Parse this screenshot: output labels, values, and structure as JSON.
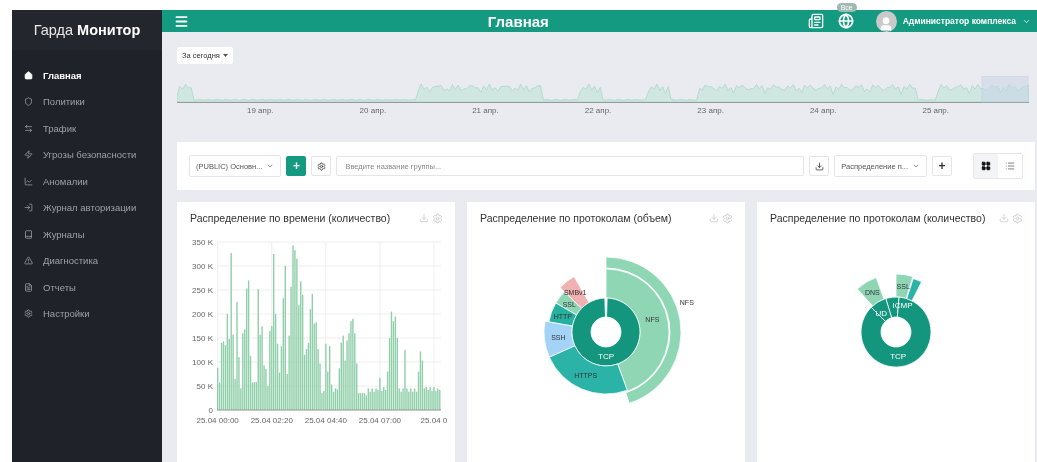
{
  "sidebar": {
    "brand_light": "Гарда",
    "brand_bold": "Монитор",
    "items": [
      {
        "label": "Главная",
        "selected": true
      },
      {
        "label": "Политики",
        "selected": false
      },
      {
        "label": "Трафик",
        "selected": false
      },
      {
        "label": "Угрозы безопасности",
        "selected": false
      },
      {
        "label": "Аномалии",
        "selected": false
      },
      {
        "label": "Журнал авторизации",
        "selected": false
      },
      {
        "label": "Журналы",
        "selected": false
      },
      {
        "label": "Диагностика",
        "selected": false
      },
      {
        "label": "Отчеты",
        "selected": false
      },
      {
        "label": "Настройки",
        "selected": false
      }
    ]
  },
  "header": {
    "title": "Главная",
    "badge": "Все",
    "user": "Администратор комплекса"
  },
  "timeline": {
    "period": "За сегодня",
    "labels": [
      "19 апр.",
      "20 апр.",
      "21 апр.",
      "22 апр.",
      "23 апр.",
      "24 апр.",
      "25 апр."
    ]
  },
  "toolbar": {
    "group": "(PUBLIC) Основн...",
    "add": "+",
    "search": {
      "placeholder": "Введите название группы..."
    },
    "layout": "Распределение п...",
    "add_widget": "+",
    "views": [
      {
        "kind": "grid",
        "selected": true
      },
      {
        "kind": "list",
        "selected": false
      }
    ]
  },
  "cards": [
    {
      "kind": "bar",
      "title": "Распределение по времени (количество)",
      "chart_data": {
        "type": "bar",
        "grid": true,
        "categories": [
          "25.04 00:00",
          null,
          null,
          null,
          null,
          null,
          null,
          null,
          null,
          null,
          null,
          null,
          null,
          null,
          null,
          null,
          null,
          null,
          null,
          null,
          null,
          null,
          null,
          null,
          null,
          null,
          null,
          null,
          "25.04 02:20",
          null,
          null,
          null,
          null,
          null,
          null,
          null,
          null,
          null,
          null,
          null,
          null,
          null,
          null,
          null,
          null,
          null,
          null,
          null,
          null,
          null,
          null,
          null,
          null,
          null,
          null,
          null,
          "25.04 04:40",
          null,
          null,
          null,
          null,
          null,
          null,
          null,
          null,
          null,
          null,
          null,
          null,
          null,
          null,
          null,
          null,
          null,
          null,
          null,
          null,
          null,
          null,
          null,
          null,
          null,
          null,
          null,
          "25.04 07:00",
          null,
          null,
          null,
          null,
          null,
          null,
          null,
          null,
          null,
          null,
          null,
          null,
          null,
          null,
          null,
          null,
          null,
          null,
          null,
          null,
          null,
          null,
          null,
          null,
          null,
          null,
          null,
          "25.04 0",
          null,
          null,
          null
        ],
        "ylim": [
          0,
          350
        ],
        "yticks": [
          {
            "value": 0,
            "label": "0"
          },
          {
            "value": 50,
            "label": "50 K"
          },
          {
            "value": 100,
            "label": "100 K"
          },
          {
            "value": 150,
            "label": "150 K"
          },
          {
            "value": 200,
            "label": "200 K"
          },
          {
            "value": 250,
            "label": "250 K"
          },
          {
            "value": 300,
            "label": "300 K"
          },
          {
            "value": 350,
            "label": "350 K"
          }
        ],
        "series": [
          {
            "color": "#8fcfa9",
            "values": [
              88,
              57,
              140,
              143,
              135,
              200,
              148,
              327,
              157,
              65,
              225,
              110,
              45,
              160,
              168,
              253,
              270,
              113,
              57,
              58,
              58,
              252,
              157,
              174,
              93,
              85,
              50,
              165,
              175,
              325,
              200,
              138,
              78,
              133,
              233,
              300,
              75,
              155,
              257,
              343,
              333,
              315,
              218,
              268,
              240,
              115,
              127,
              140,
              210,
              242,
              180,
              183,
              127,
              97,
              35,
              40,
              138,
              80,
              133,
              53,
              38,
              45,
              43,
              87,
              140,
              155,
              103,
              145,
              160,
              185,
              190,
              160,
              97,
              35,
              35,
              35,
              35,
              30,
              45,
              38,
              45,
              38,
              45,
              42,
              67,
              40,
              48,
              42,
              80,
              150,
              205,
              185,
              195,
              150,
              45,
              38,
              45,
              125,
              45,
              38,
              45,
              38,
              45,
              38,
              80,
              122,
              103,
              45,
              48,
              42,
              48,
              40,
              48,
              40,
              45,
              42
            ]
          }
        ]
      }
    },
    {
      "kind": "sunburst",
      "title": "Распределение по протоколам (объем)",
      "segments": [
        {
          "label": "NFS",
          "color": "#8fd6b4"
        },
        {
          "label": "NFS",
          "color": "#8fd6b4"
        },
        {
          "label": "SMBv1",
          "color": "#f2b1b1"
        },
        {
          "label": "SSL",
          "color": "#8fd6b4"
        },
        {
          "label": "HTTP",
          "color": "#26b0a0"
        },
        {
          "label": "SSH",
          "color": "#a3d4f7"
        },
        {
          "label": "TCP",
          "color": "#14967e"
        },
        {
          "label": "HTTPS",
          "color": "#2ab3a6"
        }
      ]
    },
    {
      "kind": "sunburst",
      "title": "Распределение по протоколам (количество)",
      "segments": [
        {
          "label": "DNS",
          "color": "#8fd6b4"
        },
        {
          "label": "SSL",
          "color": "#8fd6b4"
        },
        {
          "label": "ICMP",
          "color": "#14967e"
        },
        {
          "label": "UD",
          "color": "#14967e"
        },
        {
          "label": "TCP",
          "color": "#14967e"
        }
      ]
    }
  ]
}
